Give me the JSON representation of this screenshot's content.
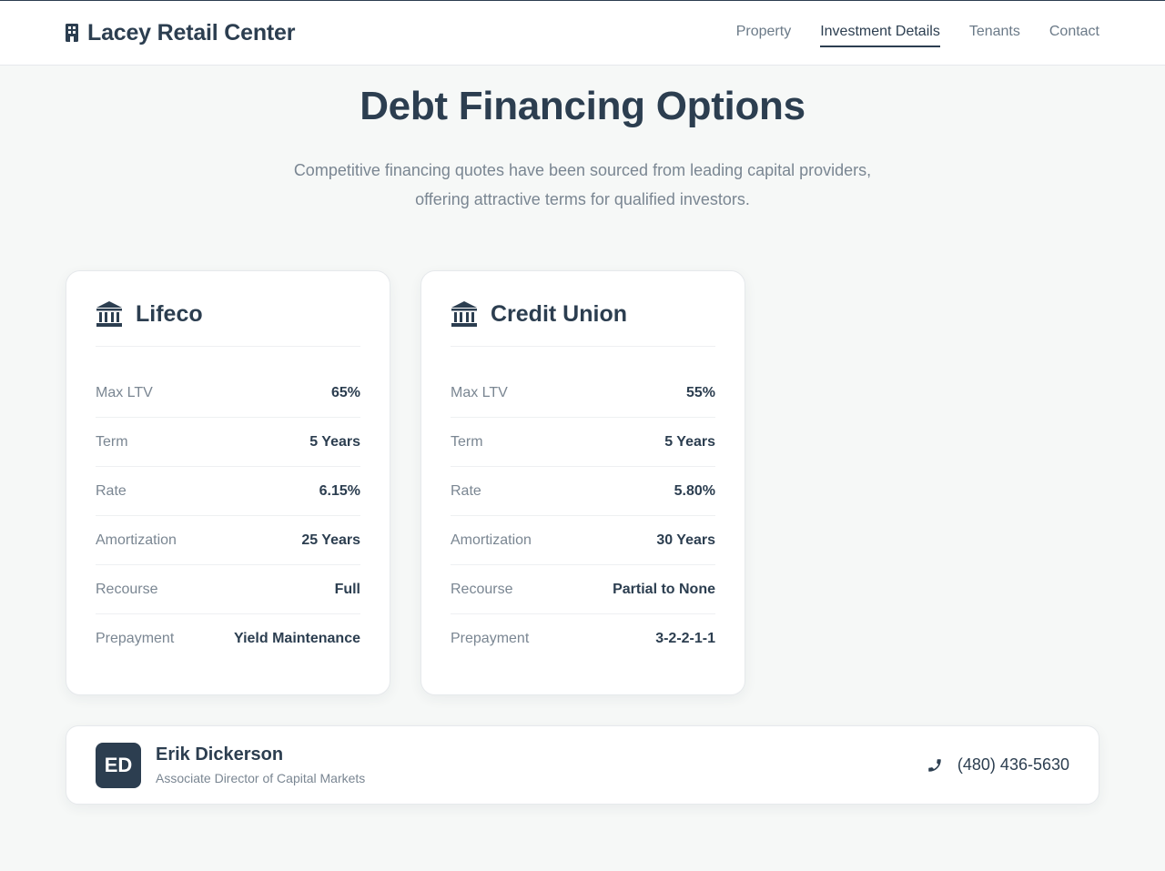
{
  "colors": {
    "primary": "#2c3e50",
    "muted": "#7a8692",
    "background": "#f6f8f7",
    "card": "#ffffff"
  },
  "header": {
    "brand_icon": "building-icon",
    "brand_title": "Lacey Retail Center",
    "nav": [
      {
        "label": "Property",
        "active": false
      },
      {
        "label": "Investment Details",
        "active": true
      },
      {
        "label": "Tenants",
        "active": false
      },
      {
        "label": "Contact",
        "active": false
      }
    ]
  },
  "main": {
    "title": "Debt Financing Options",
    "subtitle_line1": "Competitive financing quotes have been sourced from leading capital providers,",
    "subtitle_line2": "offering attractive terms for qualified investors."
  },
  "lenders": [
    {
      "icon": "bank-icon",
      "name": "Lifeco",
      "rows": [
        {
          "label": "Max LTV",
          "value": "65%"
        },
        {
          "label": "Term",
          "value": "5 Years"
        },
        {
          "label": "Rate",
          "value": "6.15%"
        },
        {
          "label": "Amortization",
          "value": "25 Years"
        },
        {
          "label": "Recourse",
          "value": "Full"
        },
        {
          "label": "Prepayment",
          "value": "Yield Maintenance"
        }
      ]
    },
    {
      "icon": "bank-icon",
      "name": "Credit Union",
      "rows": [
        {
          "label": "Max LTV",
          "value": "55%"
        },
        {
          "label": "Term",
          "value": "5 Years"
        },
        {
          "label": "Rate",
          "value": "5.80%"
        },
        {
          "label": "Amortization",
          "value": "30 Years"
        },
        {
          "label": "Recourse",
          "value": "Partial to None"
        },
        {
          "label": "Prepayment",
          "value": "3-2-2-1-1"
        }
      ]
    }
  ],
  "contact": {
    "initials": "ED",
    "name": "Erik Dickerson",
    "role": "Associate Director of Capital Markets",
    "phone_icon": "phone-icon",
    "phone": "(480) 436-5630"
  }
}
